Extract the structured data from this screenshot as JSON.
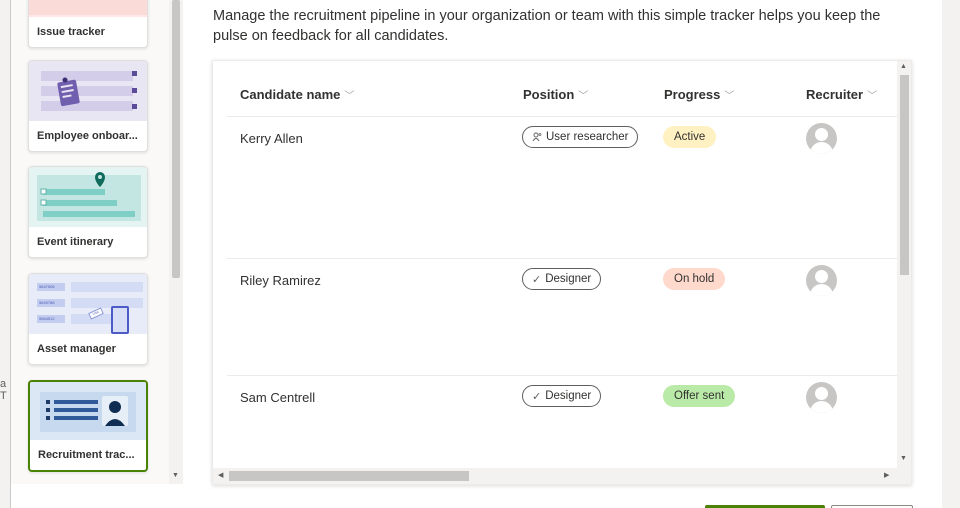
{
  "background": {
    "fragment_text": "a T"
  },
  "templates": [
    {
      "label": "Issue tracker",
      "selected": false
    },
    {
      "label": "Employee onboar...",
      "selected": false
    },
    {
      "label": "Event itinerary",
      "selected": false
    },
    {
      "label": "Asset manager",
      "selected": false
    },
    {
      "label": "Recruitment trac...",
      "selected": true
    }
  ],
  "asset_thumb_ids": [
    "5647506",
    "5649786",
    "5564512"
  ],
  "asset_thumb_tag": "VISA",
  "description": "Manage the recruitment pipeline in your organization or team with this simple tracker helps you keep the pulse on feedback for all candidates.",
  "list": {
    "columns": [
      {
        "label": "Candidate name",
        "icon": "chevron-down-icon"
      },
      {
        "label": "Position",
        "icon": "chevron-down-icon"
      },
      {
        "label": "Progress",
        "icon": "chevron-down-icon"
      },
      {
        "label": "Recruiter",
        "icon": "chevron-down-icon"
      }
    ],
    "rows": [
      {
        "name": "Kerry Allen",
        "position": "User researcher",
        "position_icon": "person-icon",
        "progress": "Active",
        "progress_color": "#fff1c2",
        "recruiter_icon": "avatar-placeholder-icon"
      },
      {
        "name": "Riley Ramirez",
        "position": "Designer",
        "position_icon": "check-icon",
        "progress": "On hold",
        "progress_color": "#fed9cc",
        "recruiter_icon": "avatar-placeholder-icon"
      },
      {
        "name": "Sam Centrell",
        "position": "Designer",
        "position_icon": "check-icon",
        "progress": "Offer sent",
        "progress_color": "#baeaa8",
        "recruiter_icon": "avatar-placeholder-icon"
      }
    ]
  },
  "colors": {
    "selected_border": "#498205",
    "primary_button": "#498205"
  }
}
